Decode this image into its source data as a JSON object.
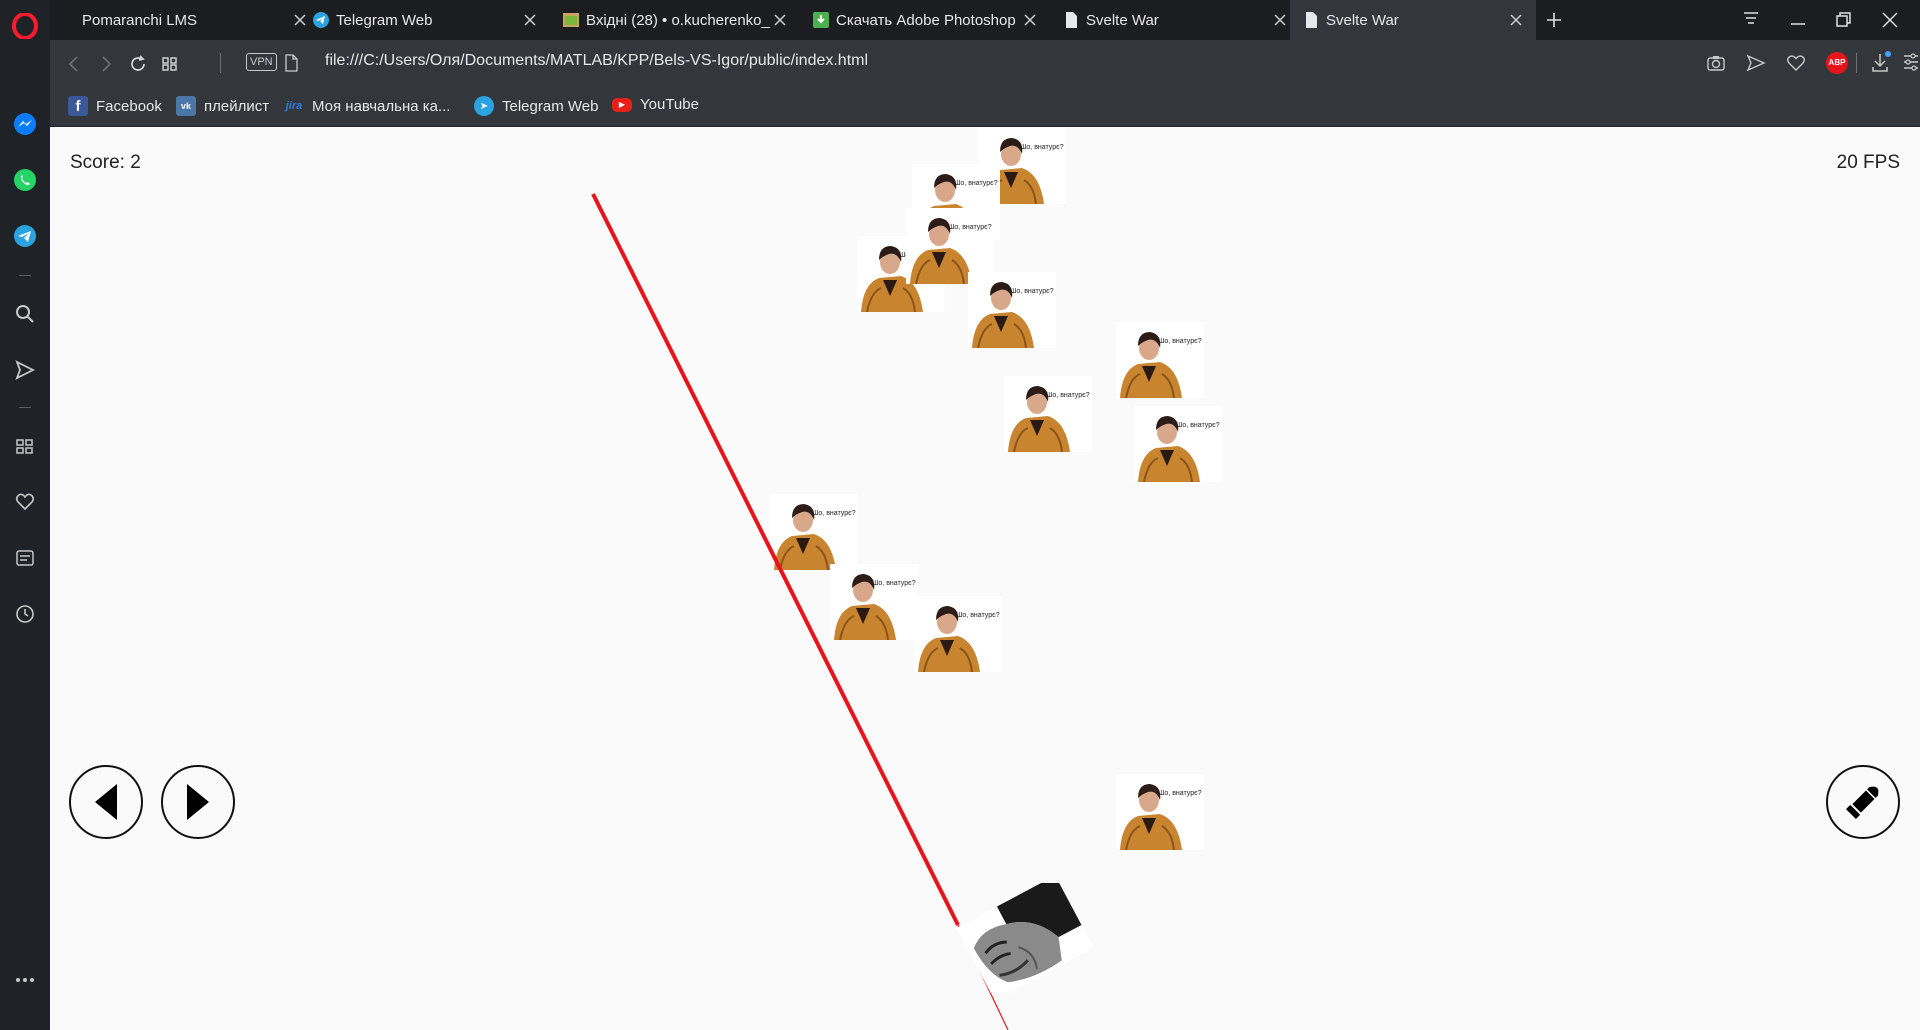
{
  "browser": {
    "tabs": [
      {
        "title": "Pomaranchi LMS",
        "icon": "pomaranchi-icon",
        "active": false
      },
      {
        "title": "Telegram Web",
        "icon": "telegram-icon",
        "active": false
      },
      {
        "title": "Вхідні (28) • o.kucherenko_",
        "icon": "gmail-icon",
        "active": false
      },
      {
        "title": "Скачать Adobe Photoshop",
        "icon": "download-green-icon",
        "active": false
      },
      {
        "title": "Svelte War",
        "icon": "page-icon",
        "active": false
      },
      {
        "title": "Svelte War",
        "icon": "page-icon",
        "active": true
      }
    ],
    "vpn_label": "VPN",
    "url": "file:///C:/Users/Оля/Documents/MATLAB/KPP/Bels-VS-Igor/public/index.html",
    "adblock_label": "ABP",
    "bookmarks": [
      {
        "label": "Facebook",
        "icon": "facebook-icon",
        "glyph": "f",
        "color": "#3b5998"
      },
      {
        "label": "плейлист",
        "icon": "vk-icon",
        "glyph": "vk",
        "color": "#4a76a8"
      },
      {
        "label": "Моя навчальна ка...",
        "icon": "jira-icon",
        "glyph": "jira",
        "color": "#2d7be5"
      },
      {
        "label": "Telegram Web",
        "icon": "telegram-icon",
        "glyph": "➤",
        "color": "#2aa3e0"
      },
      {
        "label": "YouTube",
        "icon": "youtube-icon",
        "glyph": "▶",
        "color": "#e62117"
      }
    ]
  },
  "game": {
    "score_text": "Score: 2",
    "fps_text": "20 FPS",
    "enemy_caption": "Шо, внатурє?",
    "laser_color": "#e8141c"
  }
}
